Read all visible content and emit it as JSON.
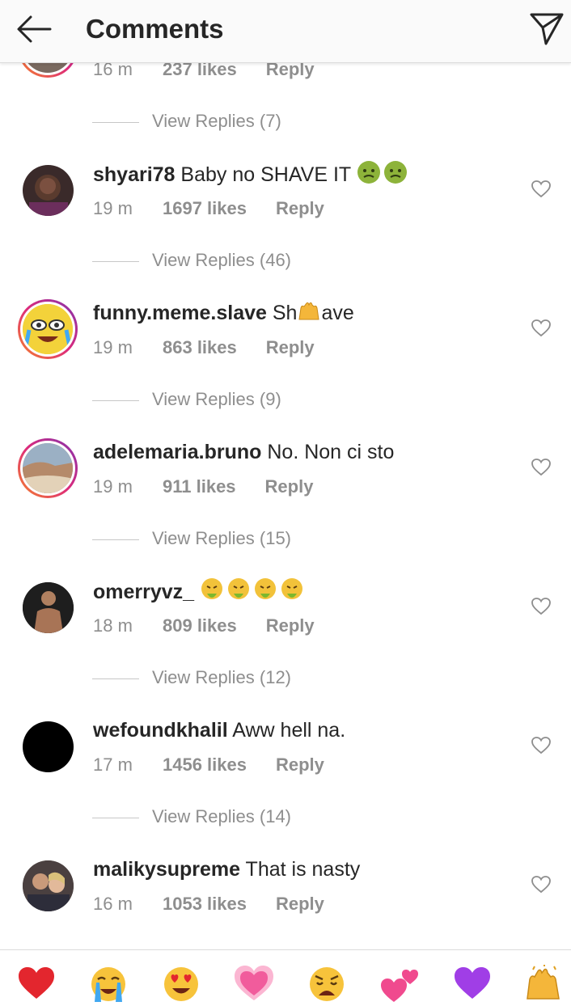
{
  "header": {
    "title": "Comments",
    "back_icon": "arrow-left-icon",
    "send_icon": "paper-plane-icon"
  },
  "partial_comment": {
    "time": "16 m",
    "likes": "237 likes",
    "reply": "Reply",
    "view_replies": "View Replies (7)"
  },
  "comments": [
    {
      "username": "shyari78",
      "text": "Baby no SHAVE IT",
      "emoji": "nauseated-face x2",
      "time": "19 m",
      "likes": "1697 likes",
      "reply": "Reply",
      "view_replies": "View Replies (46)"
    },
    {
      "username": "funny.meme.slave",
      "text_a": "Sh",
      "text_b": "ave",
      "emoji": "raising-hands",
      "time": "19 m",
      "likes": "863 likes",
      "reply": "Reply",
      "view_replies": "View Replies (9)"
    },
    {
      "username": "adelemaria.bruno",
      "text": "No. Non ci sto",
      "time": "19 m",
      "likes": "911 likes",
      "reply": "Reply",
      "view_replies": "View Replies (15)"
    },
    {
      "username": "omerryvz_",
      "text": "",
      "emoji": "vomiting-face x4",
      "time": "18 m",
      "likes": "809 likes",
      "reply": "Reply",
      "view_replies": "View Replies (12)"
    },
    {
      "username": "wefoundkhalil",
      "text": "Aww hell na.",
      "time": "17 m",
      "likes": "1456 likes",
      "reply": "Reply",
      "view_replies": "View Replies (14)"
    },
    {
      "username": "malikysupreme",
      "text": "That is nasty",
      "time": "16 m",
      "likes": "1053 likes",
      "reply": "Reply"
    }
  ],
  "quick_emojis": [
    "red-heart",
    "loudly-crying-face",
    "heart-eyes-face",
    "growing-heart",
    "weary-face",
    "two-hearts",
    "purple-heart",
    "raising-hands"
  ],
  "colors": {
    "text": "#262626",
    "muted": "#8e8e8e",
    "story_ring_start": "#f58529",
    "story_ring_end": "#8134af"
  }
}
